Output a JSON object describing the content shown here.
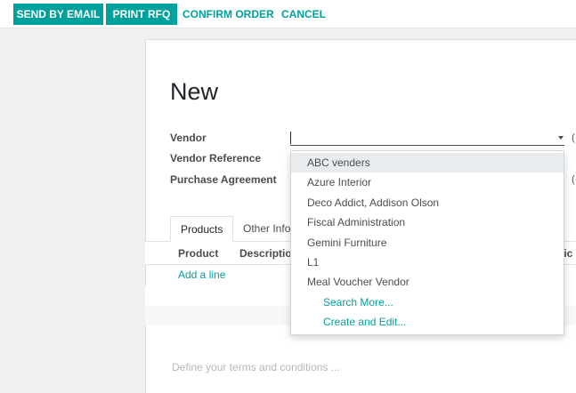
{
  "toolbar": {
    "send_by_email": "SEND BY EMAIL",
    "print_rfq": "PRINT RFQ",
    "confirm_order": "CONFIRM ORDER",
    "cancel": "CANCEL"
  },
  "form": {
    "title": "New",
    "vendor_label": "Vendor",
    "vendor_value": "",
    "vendor_reference_label": "Vendor Reference",
    "purchase_agreement_label": "Purchase Agreement",
    "edge_glyph_1": "(",
    "edge_glyph_2": "("
  },
  "tabs": [
    {
      "label": "Products",
      "active": true
    },
    {
      "label": "Other Information",
      "active": false
    }
  ],
  "table": {
    "headers": [
      "Product",
      "Description",
      "ptic"
    ],
    "add_line": "Add a line"
  },
  "terms_placeholder": "Define your terms and conditions ...",
  "vendor_dropdown": {
    "options": [
      {
        "label": "ABC venders",
        "highlighted": true
      },
      {
        "label": "Azure Interior",
        "highlighted": false
      },
      {
        "label": "Deco Addict, Addison Olson",
        "highlighted": false
      },
      {
        "label": "Fiscal Administration",
        "highlighted": false
      },
      {
        "label": "Gemini Furniture",
        "highlighted": false
      },
      {
        "label": "L1",
        "highlighted": false
      },
      {
        "label": "Meal Voucher Vendor",
        "highlighted": false
      }
    ],
    "search_more": "Search More...",
    "create_and_edit": "Create and Edit..."
  },
  "colors": {
    "accent": "#00a09d",
    "text": "#4c4c4c",
    "highlight": "#e9ecef"
  }
}
